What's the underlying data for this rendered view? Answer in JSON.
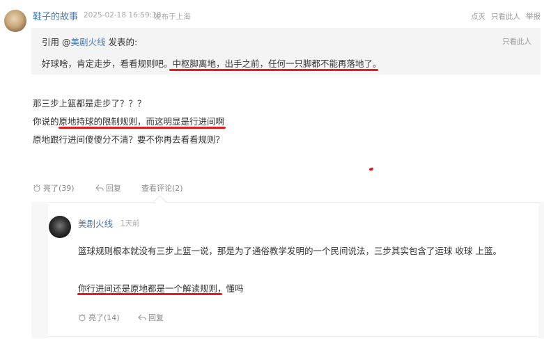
{
  "post": {
    "username": "鞋子的故事",
    "time": "2025-02-18 16:59:18",
    "location": "发布于上海",
    "actions": {
      "downvote": "点灭",
      "only_this": "只看此人",
      "report": "举报"
    }
  },
  "quote": {
    "prefix": "引用 @",
    "user": "美剧火线",
    "suffix": " 发表的:",
    "only_this": "只看此人",
    "text_a": "好球啥，肯定走步，看看规则吧。",
    "text_b": "中枢脚离地，出手之前，任何一只脚都不能再落地了。"
  },
  "body": {
    "line1": "那三步上篮都是走步了？？？",
    "line2": "你说的原地持球的限制规则，而这明显是行进间啊",
    "line3": "原地跟行进间傻傻分不清？要不你再去看看规则？"
  },
  "post_actions": {
    "like": "亮了(39)",
    "reply": "回复",
    "view_comments": "查看评论(2)"
  },
  "reply": {
    "username": "美剧火线",
    "time": "1天前",
    "text1": "篮球规则根本就没有三步上篮一说，那是为了通俗教学发明的一个民间说法，三步其实包含了运球 收球 上篮。",
    "text2": "你行进间还是原地都是一个解读规则，懂吗",
    "like": "亮了(14)",
    "reply": "回复"
  },
  "colors": {
    "link": "#4a7ab5",
    "annotation": "#e02020"
  },
  "icons": [
    "like-icon",
    "reply-icon"
  ]
}
